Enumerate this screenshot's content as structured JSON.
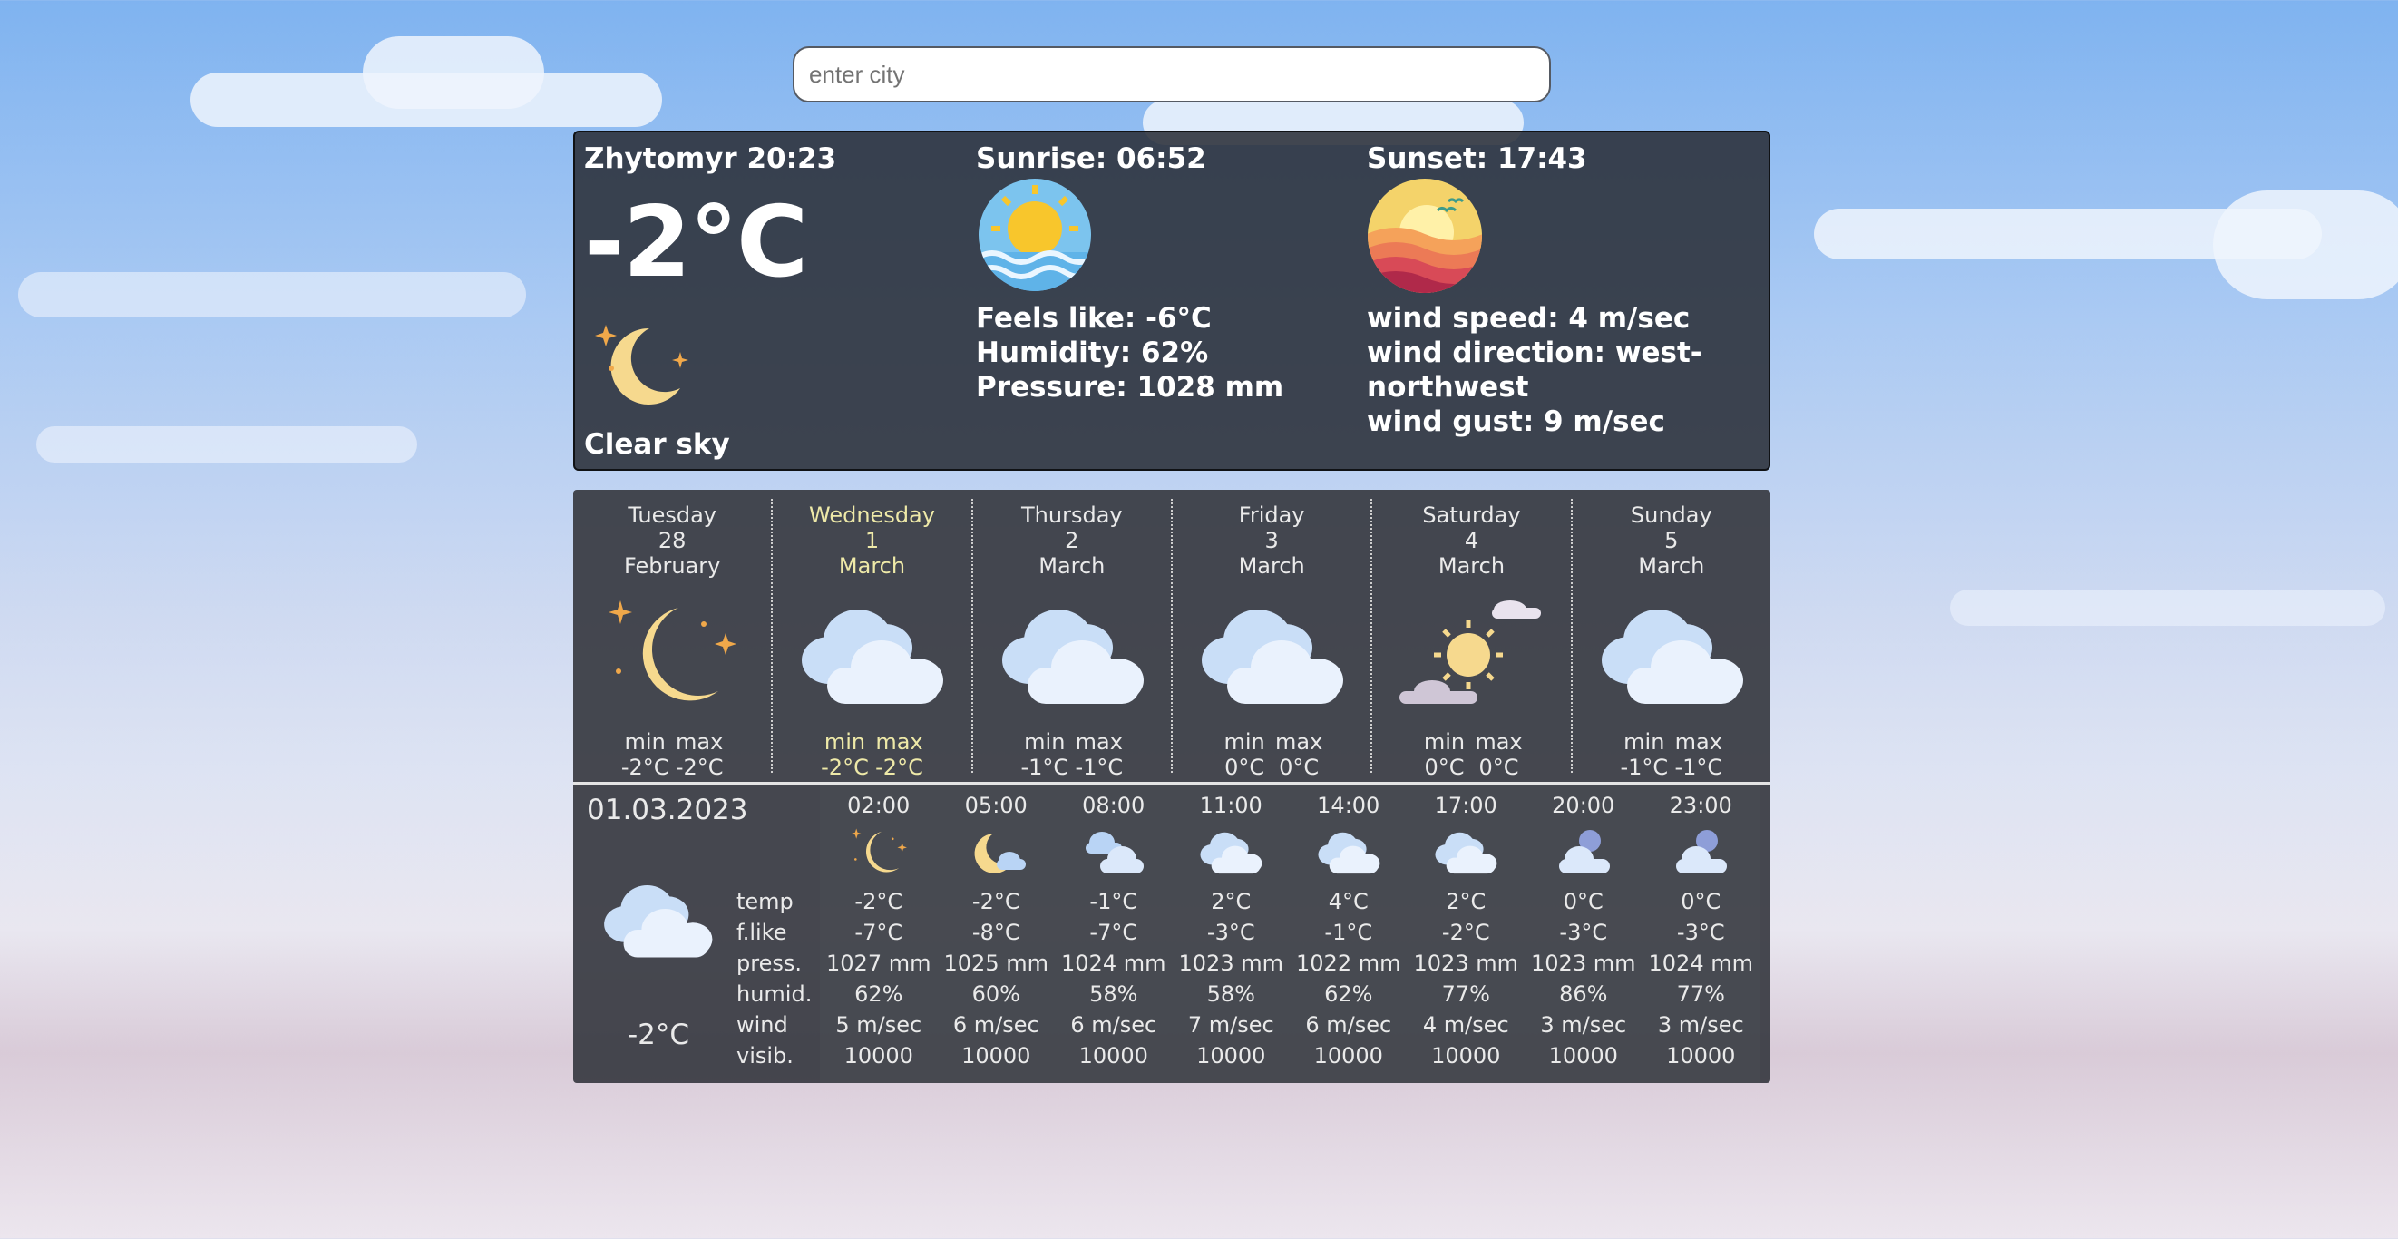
{
  "search": {
    "placeholder": "enter city",
    "value": ""
  },
  "current": {
    "city_time": "Zhytomyr 20:23",
    "temp": "-2°C",
    "description": "Clear sky",
    "sunrise": "Sunrise: 06:52",
    "sunset": "Sunset: 17:43",
    "feels_like": "Feels like: -6°C",
    "humidity": "Humidity: 62%",
    "pressure": "Pressure: 1028 mm",
    "wind_speed": "wind speed: 4 m/sec",
    "wind_direction_1": "wind direction: west-",
    "wind_direction_2": "northwest",
    "wind_gust": "wind gust: 9 m/sec"
  },
  "days": [
    {
      "weekday": "Tuesday",
      "day": "28",
      "month": "February",
      "icon": "moon-stars-icon",
      "min_label": "min",
      "max_label": "max",
      "min": "-2°C",
      "max": "-2°C",
      "selected": false
    },
    {
      "weekday": "Wednesday",
      "day": "1",
      "month": "March",
      "icon": "cloud-icon",
      "min_label": "min",
      "max_label": "max",
      "min": "-2°C",
      "max": "-2°C",
      "selected": true
    },
    {
      "weekday": "Thursday",
      "day": "2",
      "month": "March",
      "icon": "cloud-icon",
      "min_label": "min",
      "max_label": "max",
      "min": "-1°C",
      "max": "-1°C",
      "selected": false
    },
    {
      "weekday": "Friday",
      "day": "3",
      "month": "March",
      "icon": "cloud-icon",
      "min_label": "min",
      "max_label": "max",
      "min": "0°C",
      "max": "0°C",
      "selected": false
    },
    {
      "weekday": "Saturday",
      "day": "4",
      "month": "March",
      "icon": "sun-clouds-icon",
      "min_label": "min",
      "max_label": "max",
      "min": "0°C",
      "max": "0°C",
      "selected": false
    },
    {
      "weekday": "Sunday",
      "day": "5",
      "month": "March",
      "icon": "cloud-icon",
      "min_label": "min",
      "max_label": "max",
      "min": "-1°C",
      "max": "-1°C",
      "selected": false
    }
  ],
  "hourly": {
    "date": "01.03.2023",
    "temp": "-2°C",
    "labels": [
      "temp",
      "f.like",
      "press.",
      "humid.",
      "wind",
      "visib."
    ],
    "columns": [
      {
        "time": "02:00",
        "icon": "moon-stars-icon",
        "temp": "-2°C",
        "flike": "-7°C",
        "press": "1027 mm",
        "humid": "62%",
        "wind": "5 m/sec",
        "visib": "10000"
      },
      {
        "time": "05:00",
        "icon": "moon-cloud-icon",
        "temp": "-2°C",
        "flike": "-8°C",
        "press": "1025 mm",
        "humid": "60%",
        "wind": "6 m/sec",
        "visib": "10000"
      },
      {
        "time": "08:00",
        "icon": "clouds-icon",
        "temp": "-1°C",
        "flike": "-7°C",
        "press": "1024 mm",
        "humid": "58%",
        "wind": "6 m/sec",
        "visib": "10000"
      },
      {
        "time": "11:00",
        "icon": "cloud-icon",
        "temp": "2°C",
        "flike": "-3°C",
        "press": "1023 mm",
        "humid": "58%",
        "wind": "7 m/sec",
        "visib": "10000"
      },
      {
        "time": "14:00",
        "icon": "cloud-icon",
        "temp": "4°C",
        "flike": "-1°C",
        "press": "1022 mm",
        "humid": "62%",
        "wind": "6 m/sec",
        "visib": "10000"
      },
      {
        "time": "17:00",
        "icon": "cloud-icon",
        "temp": "2°C",
        "flike": "-2°C",
        "press": "1023 mm",
        "humid": "77%",
        "wind": "4 m/sec",
        "visib": "10000"
      },
      {
        "time": "20:00",
        "icon": "night-cloud-icon",
        "temp": "0°C",
        "flike": "-3°C",
        "press": "1023 mm",
        "humid": "86%",
        "wind": "3 m/sec",
        "visib": "10000"
      },
      {
        "time": "23:00",
        "icon": "night-cloud-icon",
        "temp": "0°C",
        "flike": "-3°C",
        "press": "1024 mm",
        "humid": "77%",
        "wind": "3 m/sec",
        "visib": "10000"
      }
    ]
  },
  "colors": {
    "selected_day": "#eee9a8",
    "panel_bg": "#2a2f38",
    "text": "#ffffff"
  }
}
